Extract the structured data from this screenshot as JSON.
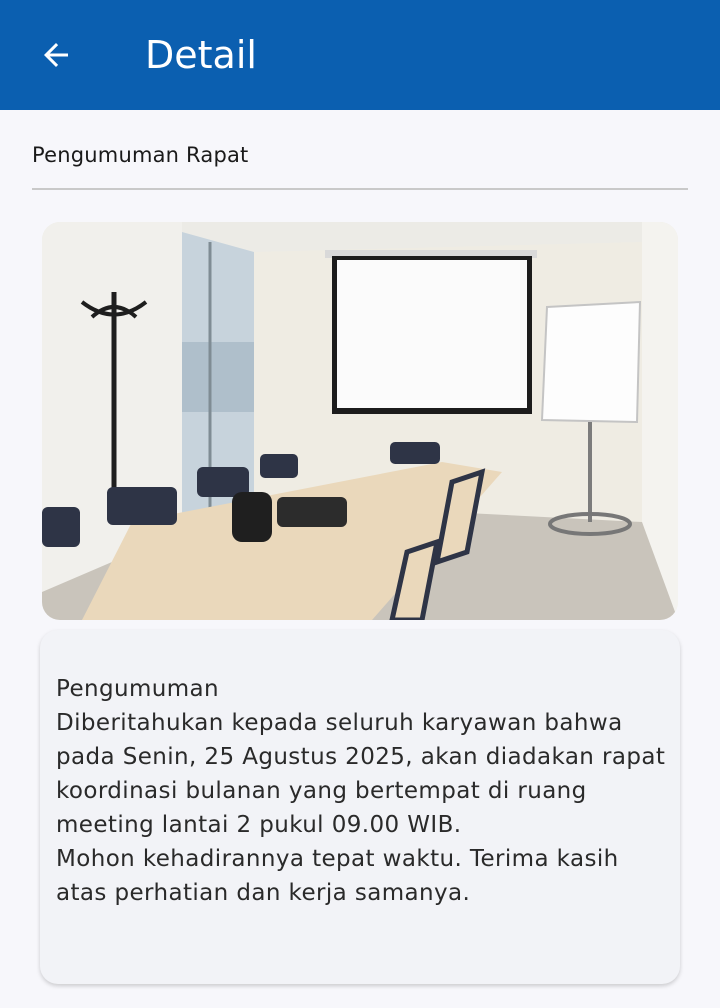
{
  "appbar": {
    "back_icon": "arrow-left-icon",
    "title": "Detail",
    "background_color": "#0b5fb0"
  },
  "announcement": {
    "section_title": "Pengumuman Rapat",
    "image_description_icon": "meeting-room-photo",
    "body": "Pengumuman\nDiberitahukan kepada seluruh karyawan bahwa pada Senin, 25 Agustus 2025, akan diadakan rapat koordinasi bulanan yang bertempat di ruang meeting lantai 2 pukul 09.00 WIB.\nMohon kehadirannya tepat waktu. Terima kasih atas perhatian dan kerja samanya."
  }
}
